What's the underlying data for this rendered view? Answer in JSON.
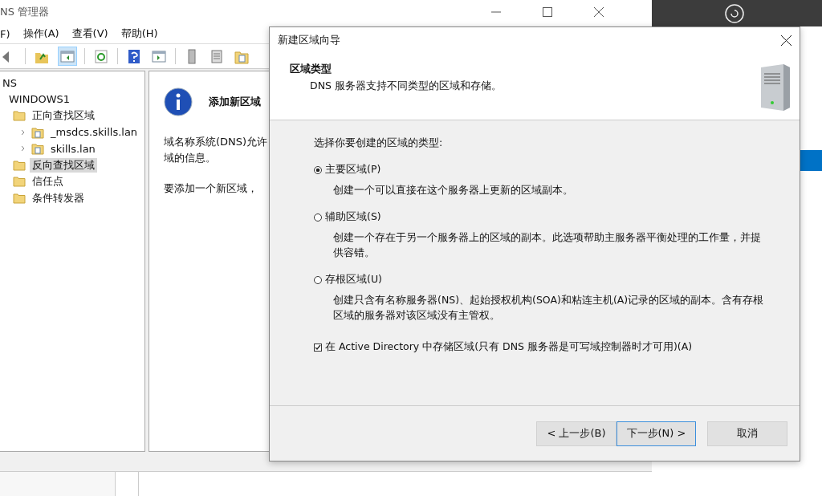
{
  "main_window": {
    "title": "NS 管理器",
    "menu": [
      "F)",
      "操作(A)",
      "查看(V)",
      "帮助(H)"
    ],
    "tree": [
      {
        "label": "NS",
        "selected": false,
        "children": [
          {
            "label": "WINDOWS1",
            "selected": false,
            "children": [
              {
                "label": "正向查找区域",
                "kind": "folder",
                "selected": false,
                "children": [
                  {
                    "label": "_msdcs.skills.lan",
                    "kind": "zone",
                    "selected": false,
                    "expanded": false
                  },
                  {
                    "label": "skills.lan",
                    "kind": "zone",
                    "selected": false,
                    "expanded": false
                  }
                ]
              },
              {
                "label": "反向查找区域",
                "kind": "folder",
                "selected": true
              },
              {
                "label": "信任点",
                "kind": "folder",
                "selected": false
              },
              {
                "label": "条件转发器",
                "kind": "folder",
                "selected": false
              }
            ]
          }
        ]
      }
    ],
    "info_panel": {
      "heading": "添加新区域",
      "lines": [
        "域名称系统(DNS)允许",
        "域的信息。",
        "要添加一个新区域，"
      ]
    }
  },
  "dialog": {
    "title": "新建区域向导",
    "heading": "区域类型",
    "subheading": "DNS 服务器支持不同类型的区域和存储。",
    "prompt": "选择你要创建的区域的类型:",
    "options": [
      {
        "label": "主要区域(P)",
        "selected": true,
        "description": "创建一个可以直接在这个服务器上更新的区域副本。"
      },
      {
        "label": "辅助区域(S)",
        "selected": false,
        "description": "创建一个存在于另一个服务器上的区域的副本。此选项帮助主服务器平衡处理的工作量，并提供容错。"
      },
      {
        "label": "存根区域(U)",
        "selected": false,
        "description": "创建只含有名称服务器(NS)、起始授权机构(SOA)和粘连主机(A)记录的区域的副本。含有存根区域的服务器对该区域没有主管权。"
      }
    ],
    "store_option": {
      "label": "在 Active Directory 中存储区域(只有 DNS 服务器是可写域控制器时才可用)(A)",
      "checked": true
    },
    "buttons": [
      {
        "label": "< 上一步(B)",
        "kind": "back",
        "focused": false
      },
      {
        "label": "下一步(N) >",
        "kind": "next",
        "focused": true
      },
      {
        "label": "取消",
        "kind": "cancel",
        "focused": false
      }
    ]
  }
}
